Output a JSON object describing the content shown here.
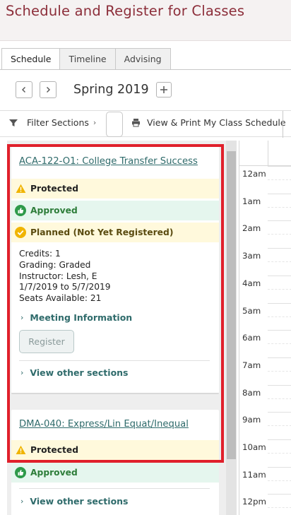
{
  "header": {
    "title": "Schedule and Register for Classes"
  },
  "tabs": [
    {
      "label": "Schedule",
      "active": true
    },
    {
      "label": "Timeline",
      "active": false
    },
    {
      "label": "Advising",
      "active": false
    }
  ],
  "term": {
    "label": "Spring 2019",
    "prev_icon": "chevron-left-icon",
    "next_icon": "chevron-right-icon",
    "add_icon": "plus-icon"
  },
  "toolbar": {
    "filter_label": "Filter Sections",
    "print_label": "View & Print My Class Schedule"
  },
  "courses": [
    {
      "title": "ACA-122-O1: College Transfer Success",
      "statuses": [
        "Protected",
        "Approved",
        "Planned (Not Yet Registered)"
      ],
      "credits": "Credits: 1",
      "grading": "Grading: Graded",
      "instructor": "Instructor: Lesh, E",
      "dates": "1/7/2019 to 5/7/2019",
      "seats": "Seats Available:  21",
      "meeting_label": "Meeting Information",
      "register_label": "Register",
      "other_sections_label": "View other sections"
    },
    {
      "title": "DMA-040: Express/Lin Equat/Inequal",
      "statuses": [
        "Protected",
        "Approved"
      ],
      "other_sections_label": "View other sections"
    }
  ],
  "calendar": {
    "hours": [
      "12am",
      "1am",
      "2am",
      "3am",
      "4am",
      "5am",
      "6am",
      "7am",
      "8am",
      "9am",
      "10am",
      "11am",
      "12pm"
    ]
  },
  "colors": {
    "title": "#8c2e3a",
    "link": "#2f6b6b",
    "protected_bg": "#fff9dc",
    "approved_bg": "#e5f6ee",
    "approved_text": "#2e7d3a",
    "highlight": "#e0202b"
  }
}
